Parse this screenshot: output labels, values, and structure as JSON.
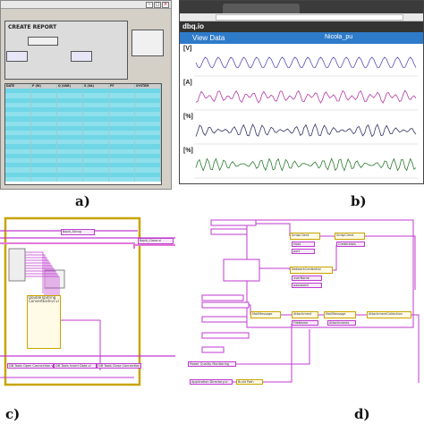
{
  "captions": {
    "a": "a)",
    "b": "b)",
    "c": "c)",
    "d": "d)"
  },
  "panel_a": {
    "button_label": "CREATE REPORT",
    "table_header": [
      "DATE",
      "P (W)",
      "Q (VAR)",
      "S (VA)",
      "PF",
      "SYSTEM"
    ],
    "rows_count_note": "",
    "colors": {
      "row_selected": "#6fd6e6",
      "background": "#d4d0c8"
    }
  },
  "panel_b": {
    "logo": "dbq.io",
    "view_title": "View Data",
    "view_name": "Nicola_pu",
    "charts": [
      {
        "label": "[V]",
        "color": "#5a4fb8"
      },
      {
        "label": "[A]",
        "color": "#b23aa6"
      },
      {
        "label": "[%]",
        "color": "#333366"
      },
      {
        "label": "[%]",
        "color": "#2e7d32"
      }
    ],
    "colors": {
      "header": "#333333",
      "view_bar": "#2e7bc9"
    }
  },
  "panel_c": {
    "nodes": [
      "Bajdi_String",
      "Bajdi_Close.vi",
      "DoubleToString ConvertEsdnvi.vi",
      "DB Tools Open Connection.vi",
      "DB Tools Insert Data.vi",
      "DB Tools Close Connection.vi"
    ],
    "colors": {
      "wire": "#c03ad0",
      "frame": "#c8a400"
    }
  },
  "panel_d": {
    "nodes": [
      "SmtpClient",
      "SmtpClient",
      "Credentials",
      "Host",
      "port",
      "NetworkCredential",
      "userName",
      "password",
      "MailMessage",
      "MailMessage",
      "Attachment",
      "AttachmentCollection",
      "Attachments",
      "FileName",
      "Application Directory.vi",
      "Build Path",
      "Power Quality Monitoring"
    ],
    "colors": {
      "wire": "#c03ad0",
      "node": "#c8a400"
    }
  }
}
